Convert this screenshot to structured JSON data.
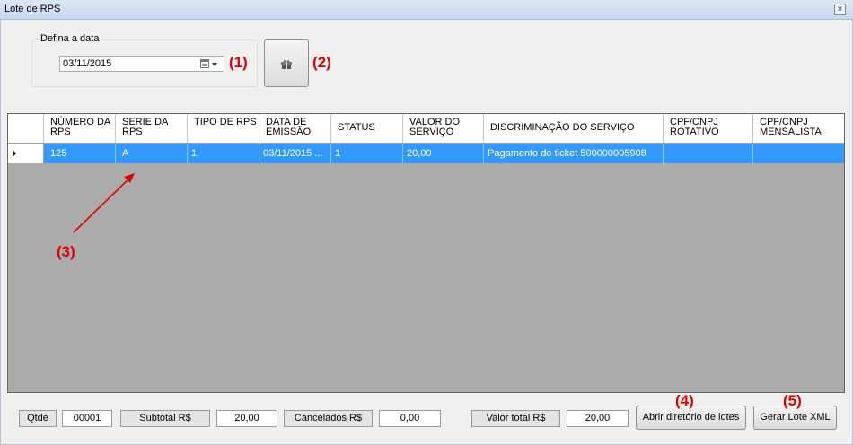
{
  "window": {
    "title": "Lote de RPS",
    "close_glyph": "×"
  },
  "date_group": {
    "legend": "Defina a data",
    "date_value": "03/11/2015",
    "calendar_icon": "calendar-icon",
    "dropdown_icon": "chevron-down-icon"
  },
  "generate_button": {
    "icon": "gift-icon"
  },
  "annotations": {
    "a1": "(1)",
    "a2": "(2)",
    "a3": "(3)",
    "a4": "(4)",
    "a5": "(5)",
    "color": "#e00000"
  },
  "grid": {
    "columns": [
      "NÚMERO DA RPS",
      "SERIE DA RPS",
      "TIPO DE RPS",
      "DATA DE EMISSÃO",
      "STATUS",
      "VALOR DO SERVIÇO",
      "DISCRIMINAÇÃO DO SERVIÇO",
      "CPF/CNPJ ROTATIVO",
      "CPF/CNPJ MENSALISTA"
    ],
    "rows": [
      [
        "125",
        "A",
        "1",
        "03/11/2015 ...",
        "1",
        "20,00",
        "Pagamento do ticket 500000005908",
        "",
        ""
      ]
    ],
    "selection_color": "#3399ff",
    "background_color": "#ababab"
  },
  "footer": {
    "qtde_label": "Qtde",
    "qtde_value": "00001",
    "subtotal_label": "Subtotal R$",
    "subtotal_value": "20,00",
    "cancelados_label": "Cancelados R$",
    "cancelados_value": "0,00",
    "total_label": "Valor total R$",
    "total_value": "20,00",
    "open_dir_button": "Abrir diretório de lotes",
    "generate_xml_button": "Gerar Lote XML"
  }
}
